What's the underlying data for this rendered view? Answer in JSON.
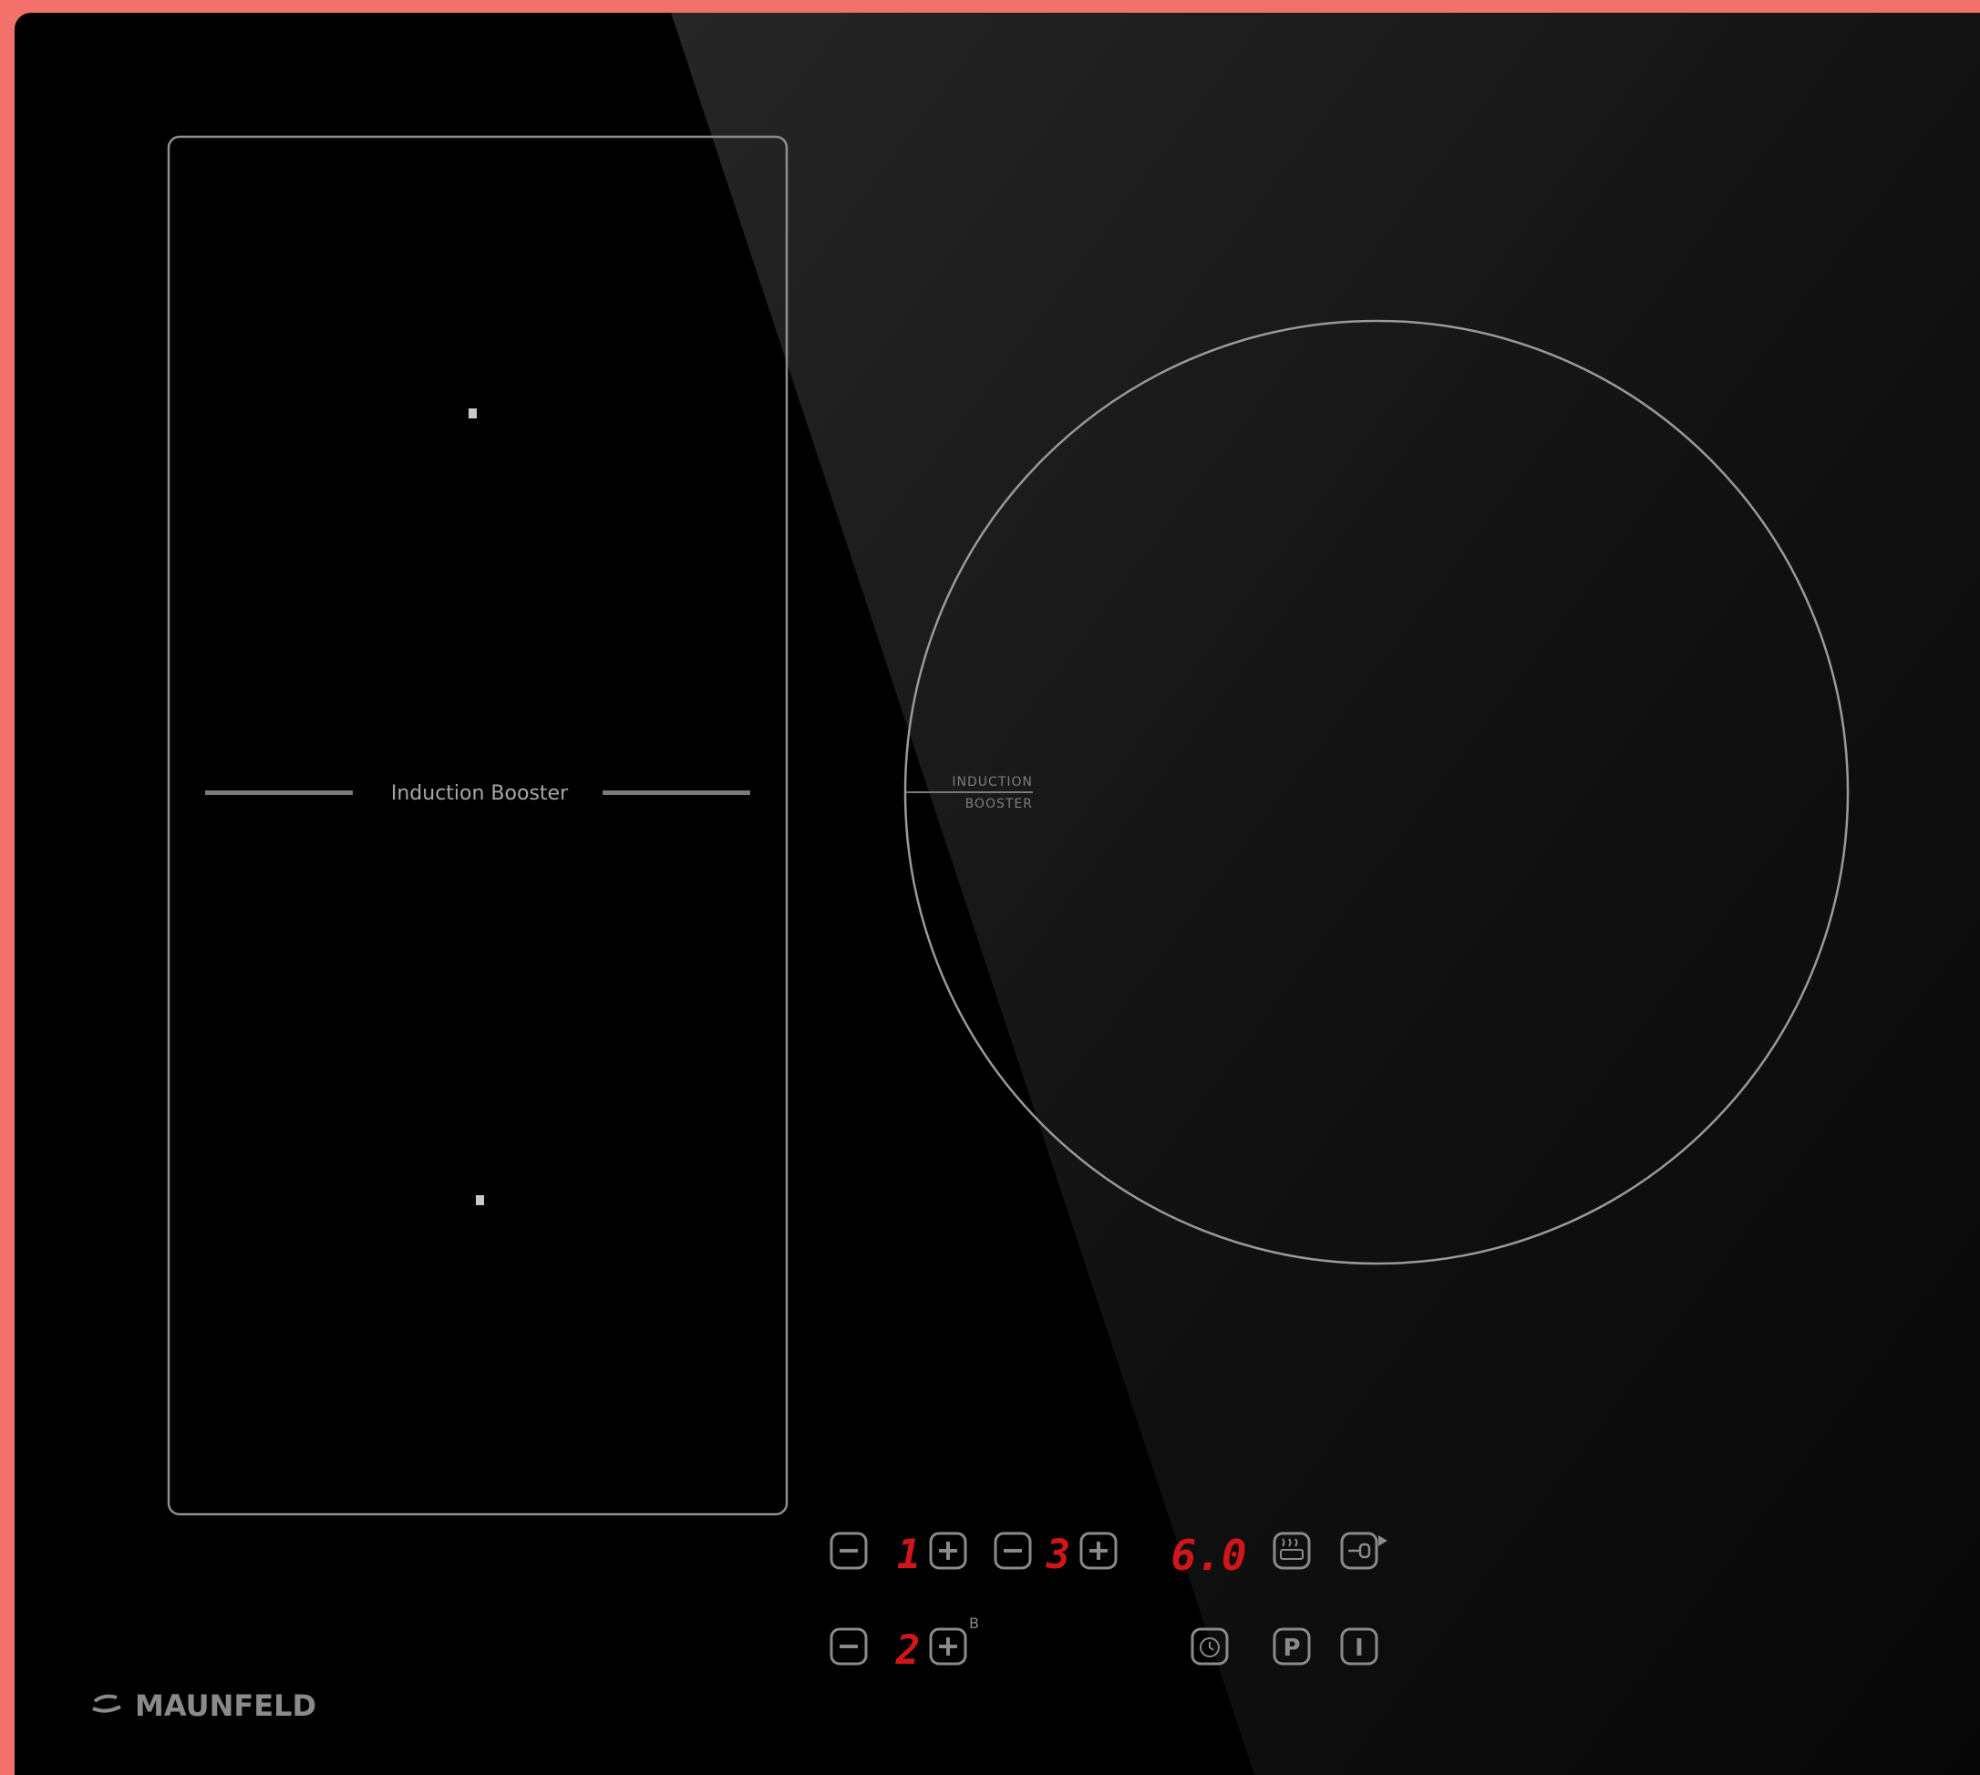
{
  "brand": "MAUNFELD",
  "left_zone": {
    "booster_label": "Induction Booster"
  },
  "right_zone": {
    "booster_label_line1": "INDUCTION",
    "booster_label_line2": "BOOSTER"
  },
  "controls": {
    "zone1_level": "1",
    "zone2_level": "2",
    "zone3_level": "3",
    "timer_display": "6.0",
    "booster_superscript": "B",
    "minus_symbol": "−",
    "plus_symbol": "+",
    "program_symbol": "P",
    "power_symbol": "I"
  },
  "colors": {
    "frame": "#f2716a",
    "glass": "#000000",
    "outline": "#9a9a9a",
    "display_red": "#d0161b"
  },
  "icons": [
    "minus-icon",
    "plus-icon",
    "heat-keep-warm-icon",
    "lock-key-icon",
    "timer-clock-icon",
    "program-icon",
    "power-icon",
    "maunfeld-logo-icon"
  ]
}
